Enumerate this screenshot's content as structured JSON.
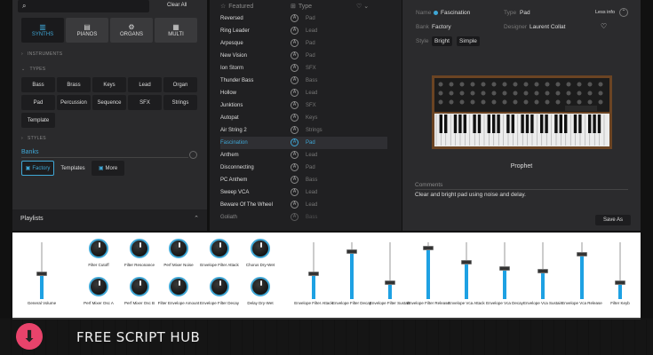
{
  "left_panel": {
    "search_placeholder": "",
    "clear_all": "Clear All",
    "categories": [
      "SYNTHS",
      "PIANOS",
      "ORGANS",
      "MULTI"
    ],
    "sections": {
      "instruments": "INSTRUMENTS",
      "types": "TYPES",
      "styles": "STYLES"
    },
    "types_row1": [
      "Bass",
      "Brass",
      "Keys",
      "Lead",
      "Organ"
    ],
    "types_row2": [
      "Pad",
      "Percussion",
      "Sequence",
      "SFX",
      "Strings"
    ],
    "types_row3": [
      "Template"
    ],
    "banks_label": "Banks",
    "bank_buttons": [
      "Factory",
      "Templates",
      "More"
    ],
    "playlists": "Playlists"
  },
  "preset_list": {
    "header_featured": "Featured",
    "header_type": "Type",
    "rows": [
      {
        "name": "Reversed",
        "type": "Pad"
      },
      {
        "name": "Ring Leader",
        "type": "Lead"
      },
      {
        "name": "Arpesque",
        "type": "Pad"
      },
      {
        "name": "New Vision",
        "type": "Pad"
      },
      {
        "name": "Ion Storm",
        "type": "SFX"
      },
      {
        "name": "Thunder Bass",
        "type": "Bass"
      },
      {
        "name": "Hollow",
        "type": "Lead"
      },
      {
        "name": "Junktions",
        "type": "SFX"
      },
      {
        "name": "Autopat",
        "type": "Keys"
      },
      {
        "name": "Air String 2",
        "type": "Strings"
      },
      {
        "name": "Fascination",
        "type": "Pad"
      },
      {
        "name": "Anthem",
        "type": "Lead"
      },
      {
        "name": "Disconnecting",
        "type": "Pad"
      },
      {
        "name": "PC Anthem",
        "type": "Bass"
      },
      {
        "name": "Sweep VCA",
        "type": "Lead"
      },
      {
        "name": "Beware Of The Wheel",
        "type": "Lead"
      },
      {
        "name": "Goliath",
        "type": "Bass"
      }
    ],
    "selected_index": 10
  },
  "info": {
    "name_label": "Name",
    "name_value": "Fascination",
    "type_label": "Type",
    "type_value": "Pad",
    "less_info": "Less info",
    "bank_label": "Bank",
    "bank_value": "Factory",
    "designer_label": "Designer",
    "designer_value": "Laurent Collat",
    "style_label": "Style",
    "style_tags": [
      "Bright",
      "Simple"
    ],
    "instrument_name": "Prophet",
    "comments_label": "Comments",
    "comments_text": "Clear and bright pad using noise and delay.",
    "save_as": "Save As"
  },
  "controls": {
    "knobs_top": [
      "Filter Cutoff",
      "Filter Resonance",
      "Perf Mixer Noise",
      "Envelope Filter Attack",
      "Chorus Dry-Wet"
    ],
    "knobs_bottom": [
      "Perf Mixer Osc A",
      "Perf Mixer Osc B",
      "Filter Envelope Amount",
      "Envelope Filter Decay",
      "Delay Dry-Wet"
    ],
    "general_volume": "General Volume",
    "general_volume_level": 0.45,
    "faders": [
      {
        "label": "Envelope Filter Attack",
        "level": 0.45
      },
      {
        "label": "Envelope Filter Decay",
        "level": 0.85
      },
      {
        "label": "Envelope Filter Sustain",
        "level": 0.3
      },
      {
        "label": "Envelope Filter Release",
        "level": 0.9
      },
      {
        "label": "Envelope Vca Attack",
        "level": 0.65
      },
      {
        "label": "Envelope Vca Decay",
        "level": 0.55
      },
      {
        "label": "Envelope Vca Sustain",
        "level": 0.5
      },
      {
        "label": "Envelope Vca Release",
        "level": 0.8
      },
      {
        "label": "Filter Keyb",
        "level": 0.3
      }
    ]
  },
  "watermark": {
    "text": "FREE SCRIPT HUB",
    "accent": "#e8436b"
  },
  "colors": {
    "accent": "#3fa7d6",
    "fader_fill": "#1ea1e3"
  }
}
